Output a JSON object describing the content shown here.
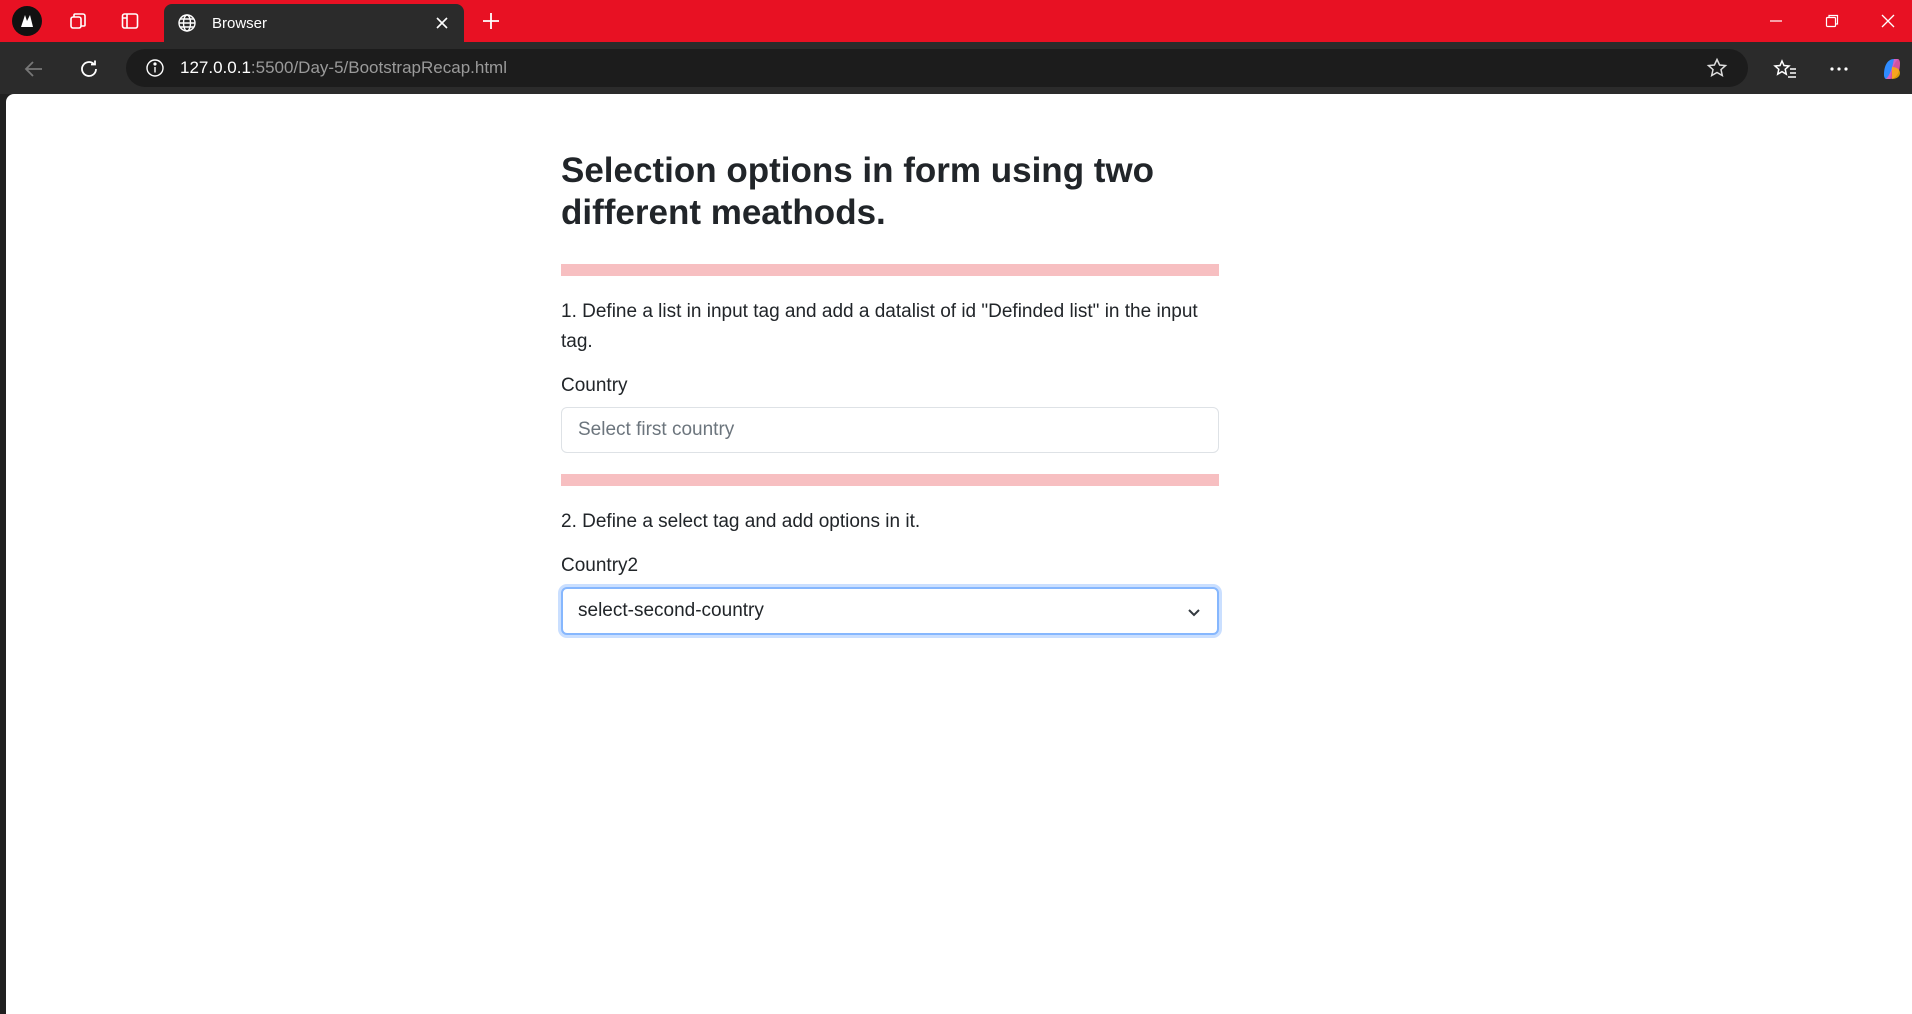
{
  "browser": {
    "tab_title": "Browser",
    "url_host": "127.0.0.1",
    "url_rest": ":5500/Day-5/BootstrapRecap.html",
    "accent_color": "#e81123"
  },
  "page": {
    "heading": "Selection options in form using two different meathods.",
    "section1_text": "1. Define a list in input tag and add a datalist of id \"Definded list\" in the input tag.",
    "country_label": "Country",
    "country_placeholder": "Select first country",
    "section2_text": "2. Define a select tag and add options in it.",
    "country2_label": "Country2",
    "country2_selected": "select-second-country",
    "divider_color": "#f7bfc1"
  }
}
